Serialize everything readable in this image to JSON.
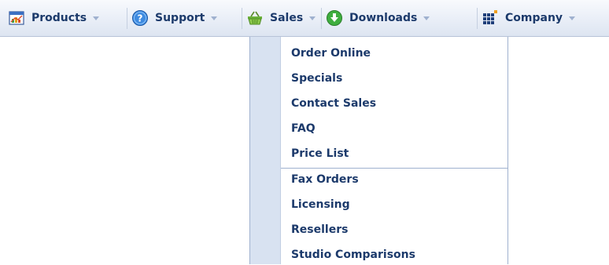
{
  "menubar": {
    "items": [
      {
        "label": "Products",
        "icon": "products-chart-icon"
      },
      {
        "label": "Support",
        "icon": "help-icon"
      },
      {
        "label": "Sales",
        "icon": "shopping-basket-icon"
      },
      {
        "label": "Downloads",
        "icon": "download-arrow-icon"
      },
      {
        "label": "Company",
        "icon": "company-grid-icon"
      }
    ]
  },
  "dropdown": {
    "open_menu": "Sales",
    "group1": [
      "Order Online",
      "Specials",
      "Contact Sales",
      "FAQ",
      "Price List"
    ],
    "group2": [
      "Fax Orders",
      "Licensing",
      "Resellers",
      "Studio Comparisons"
    ]
  },
  "colors": {
    "text": "#1c3a6b",
    "menubar_bg": "#e9eef7",
    "dropdown_gutter": "#d8e2f1",
    "dropdown_border": "#9fb1cf"
  }
}
